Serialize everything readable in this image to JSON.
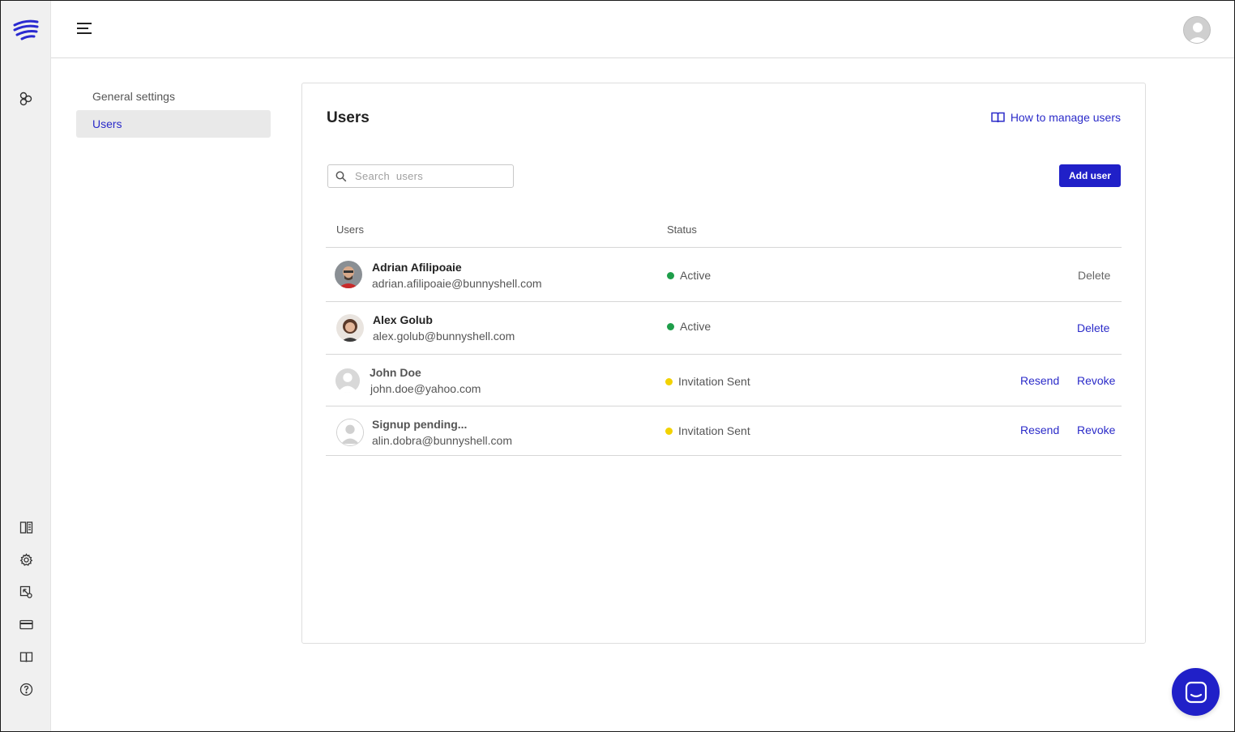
{
  "settings_nav": {
    "items": [
      {
        "label": "General settings",
        "active": false
      },
      {
        "label": "Users",
        "active": true
      }
    ]
  },
  "card": {
    "title": "Users",
    "help_link": "How to manage users"
  },
  "search": {
    "placeholder": "Search  users",
    "value": ""
  },
  "add_user_label": "Add user",
  "table": {
    "headers": {
      "users": "Users",
      "status": "Status"
    },
    "rows": [
      {
        "name": "Adrian Afilipoaie",
        "email": "adrian.afilipoaie@bunnyshell.com",
        "status": "Active",
        "actions": [
          "Delete"
        ]
      },
      {
        "name": "Alex Golub",
        "email": "alex.golub@bunnyshell.com",
        "status": "Active",
        "actions": [
          "Delete"
        ]
      },
      {
        "name": "John Doe",
        "email": "john.doe@yahoo.com",
        "status": "Invitation Sent",
        "actions": [
          "Resend",
          "Revoke"
        ]
      },
      {
        "name": "Signup pending...",
        "email": "alin.dobra@bunnyshell.com",
        "status": "Invitation Sent",
        "actions": [
          "Resend",
          "Revoke"
        ]
      }
    ]
  },
  "colors": {
    "accent": "#2020c8",
    "link": "#2b2bc9",
    "status_active": "#1e9e4a",
    "status_invited": "#f2d200"
  },
  "icons": {
    "rail_top": [
      "logo-icon",
      "components-icon"
    ],
    "rail_bottom": [
      "docs-icon",
      "settings-gear-icon",
      "integrations-icon",
      "billing-card-icon",
      "book-icon",
      "help-icon"
    ]
  }
}
